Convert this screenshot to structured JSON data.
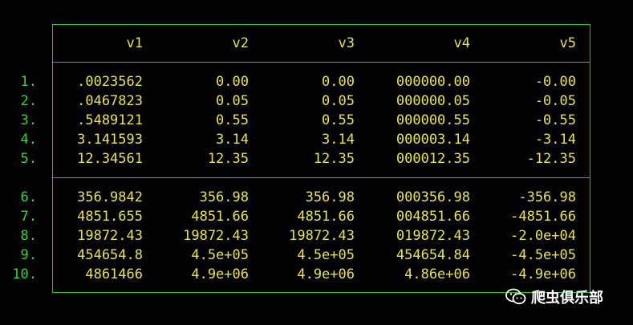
{
  "columns": [
    "v1",
    "v2",
    "v3",
    "v4",
    "v5"
  ],
  "rows": [
    {
      "num": "1.",
      "cells": [
        ".0023562",
        "0.00",
        "0.00",
        "000000.00",
        "-0.00"
      ]
    },
    {
      "num": "2.",
      "cells": [
        ".0467823",
        "0.05",
        "0.05",
        "000000.05",
        "-0.05"
      ]
    },
    {
      "num": "3.",
      "cells": [
        ".5489121",
        "0.55",
        "0.55",
        "000000.55",
        "-0.55"
      ]
    },
    {
      "num": "4.",
      "cells": [
        "3.141593",
        "3.14",
        "3.14",
        "000003.14",
        "-3.14"
      ]
    },
    {
      "num": "5.",
      "cells": [
        "12.34561",
        "12.35",
        "12.35",
        "000012.35",
        "-12.35"
      ]
    },
    {
      "num": "6.",
      "cells": [
        "356.9842",
        "356.98",
        "356.98",
        "000356.98",
        "-356.98"
      ]
    },
    {
      "num": "7.",
      "cells": [
        "4851.655",
        "4851.66",
        "4851.66",
        "004851.66",
        "-4851.66"
      ]
    },
    {
      "num": "8.",
      "cells": [
        "19872.43",
        "19872.43",
        "19872.43",
        "019872.43",
        "-2.0e+04"
      ]
    },
    {
      "num": "9.",
      "cells": [
        "454654.8",
        "4.5e+05",
        "4.5e+05",
        "454654.84",
        "-4.5e+05"
      ]
    },
    {
      "num": "10.",
      "cells": [
        "4861466",
        "4.9e+06",
        "4.9e+06",
        "4.86e+06",
        "-4.9e+06"
      ]
    }
  ],
  "watermark": {
    "text": "爬虫俱乐部",
    "icon": "wechat-icon"
  },
  "colors": {
    "background": "#000000",
    "border": "#2fbf2f",
    "values": "#e8e34a",
    "row_numbers": "#35d635"
  }
}
